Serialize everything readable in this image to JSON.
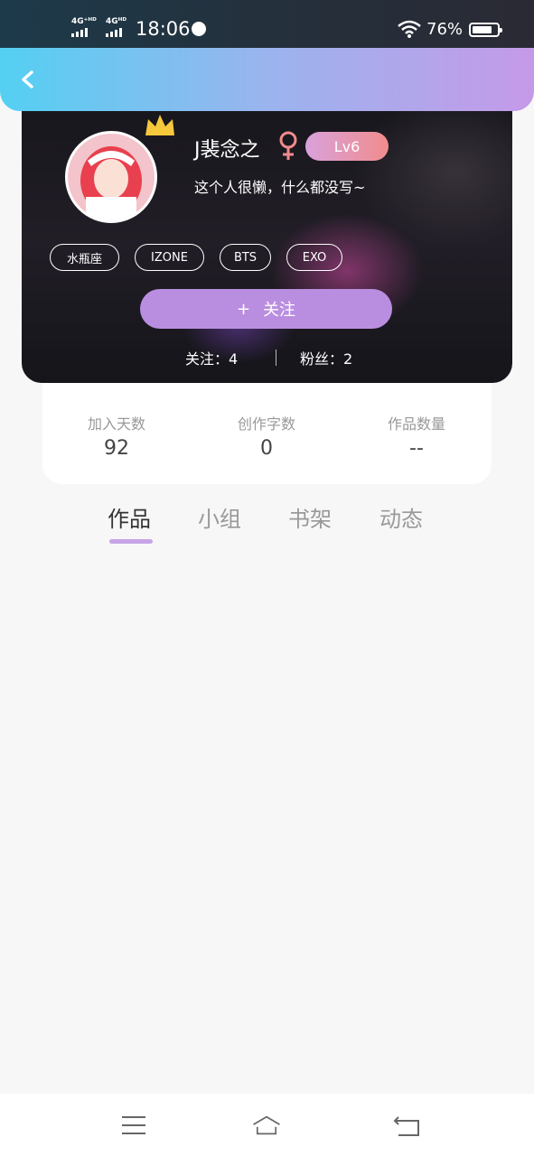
{
  "status_bar": {
    "signal1": "4G⁺ᴴᴰ",
    "signal2": "4Gᴴᴰ",
    "time": "18:06",
    "battery": "76%"
  },
  "header": {
    "back_icon": "chevron-left-icon"
  },
  "profile": {
    "username": "J裴念之",
    "gender_icon": "female-icon",
    "level": "Lv6",
    "bio": "这个人很懒，什么都没写~",
    "tags": [
      "水瓶座",
      "IZONE",
      "BTS",
      "EXO"
    ],
    "follow_icon": "+",
    "follow_label": "关注",
    "following": "关注：4",
    "fans": "粉丝：2"
  },
  "stats": [
    {
      "label": "加入天数",
      "value": "92"
    },
    {
      "label": "创作字数",
      "value": "0"
    },
    {
      "label": "作品数量",
      "value": "--"
    }
  ],
  "tabs": [
    "作品",
    "小组",
    "书架",
    "动态"
  ],
  "active_tab": "作品",
  "colors": {
    "header_start": "#54d0f2",
    "header_end": "#c59ae8",
    "follow_button": "#b98ee0",
    "level_start": "#d9a2dc",
    "level_end": "#f08c8c",
    "tab_indicator": "#c6a4e6"
  }
}
